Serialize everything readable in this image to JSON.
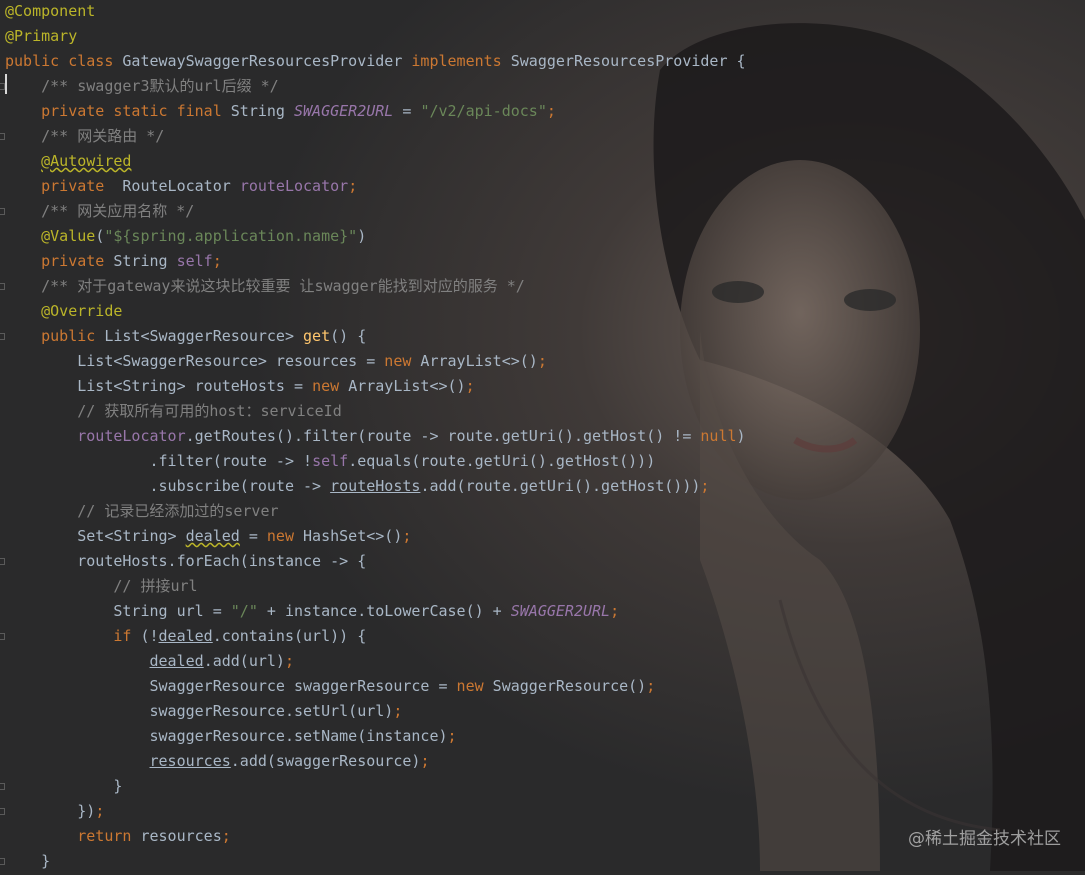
{
  "editor": {
    "lines": [
      [
        {
          "t": "@Component",
          "k": "an"
        }
      ],
      [
        {
          "t": "@Primary",
          "k": "an"
        }
      ],
      [
        {
          "t": "public class ",
          "k": "kw"
        },
        {
          "t": "GatewaySwaggerResourcesProvider ",
          "k": "tx"
        },
        {
          "t": "implements ",
          "k": "kw"
        },
        {
          "t": "SwaggerResourcesProvider {",
          "k": "tx"
        }
      ],
      [
        {
          "t": "    "
        },
        {
          "t": "/** swagger3默认的url后缀 */",
          "k": "cm"
        }
      ],
      [
        {
          "t": "    "
        },
        {
          "t": "private static final ",
          "k": "kw"
        },
        {
          "t": "String ",
          "k": "tx"
        },
        {
          "t": "SWAGGER2URL",
          "k": "st"
        },
        {
          "t": " = ",
          "k": "tx"
        },
        {
          "t": "\"/v2/api-docs\"",
          "k": "str"
        },
        {
          "t": ";",
          "k": "kw"
        }
      ],
      [
        {
          "t": "    "
        },
        {
          "t": "/** 网关路由 */",
          "k": "cm"
        }
      ],
      [
        {
          "t": "    "
        },
        {
          "t": "@Autowired",
          "k": "an",
          "u": "wv"
        }
      ],
      [
        {
          "t": "    "
        },
        {
          "t": "private  ",
          "k": "kw"
        },
        {
          "t": "RouteLocator ",
          "k": "tx"
        },
        {
          "t": "routeLocator",
          "k": "fd"
        },
        {
          "t": ";",
          "k": "kw"
        }
      ],
      [
        {
          "t": "    "
        },
        {
          "t": "/** 网关应用名称 */",
          "k": "cm"
        }
      ],
      [
        {
          "t": "    "
        },
        {
          "t": "@Value",
          "k": "an"
        },
        {
          "t": "(",
          "k": "tx"
        },
        {
          "t": "\"${spring.application.name}\"",
          "k": "str"
        },
        {
          "t": ")",
          "k": "tx"
        }
      ],
      [
        {
          "t": "    "
        },
        {
          "t": "private ",
          "k": "kw"
        },
        {
          "t": "String ",
          "k": "tx"
        },
        {
          "t": "self",
          "k": "fd"
        },
        {
          "t": ";",
          "k": "kw"
        }
      ],
      [
        {
          "t": "    "
        },
        {
          "t": "/** 对于gateway来说这块比较重要 让swagger能找到对应的服务 */",
          "k": "cm"
        }
      ],
      [
        {
          "t": "    "
        },
        {
          "t": "@Override",
          "k": "an"
        }
      ],
      [
        {
          "t": "    "
        },
        {
          "t": "public ",
          "k": "kw"
        },
        {
          "t": "List<SwaggerResource> ",
          "k": "tx"
        },
        {
          "t": "get",
          "k": "mt"
        },
        {
          "t": "() {",
          "k": "tx"
        }
      ],
      [
        {
          "t": "        "
        },
        {
          "t": "List<SwaggerResource> resources = ",
          "k": "tx"
        },
        {
          "t": "new ",
          "k": "kw"
        },
        {
          "t": "ArrayList<>()",
          "k": "tx"
        },
        {
          "t": ";",
          "k": "kw"
        }
      ],
      [
        {
          "t": "        "
        },
        {
          "t": "List<String> routeHosts = ",
          "k": "tx"
        },
        {
          "t": "new ",
          "k": "kw"
        },
        {
          "t": "ArrayList<>()",
          "k": "tx"
        },
        {
          "t": ";",
          "k": "kw"
        }
      ],
      [
        {
          "t": "        "
        },
        {
          "t": "// 获取所有可用的host：serviceId",
          "k": "cm"
        }
      ],
      [
        {
          "t": "        "
        },
        {
          "t": "routeLocator",
          "k": "fd"
        },
        {
          "t": ".getRoutes().filter(route -> route.getUri().getHost() != ",
          "k": "tx"
        },
        {
          "t": "null",
          "k": "kw"
        },
        {
          "t": ")",
          "k": "tx"
        }
      ],
      [
        {
          "t": "                "
        },
        {
          "t": ".filter(route -> !",
          "k": "tx"
        },
        {
          "t": "self",
          "k": "fd"
        },
        {
          "t": ".equals(route.getUri().getHost()))",
          "k": "tx"
        }
      ],
      [
        {
          "t": "                "
        },
        {
          "t": ".subscribe(route -> ",
          "k": "tx"
        },
        {
          "t": "routeHosts",
          "k": "tx",
          "u": "ul"
        },
        {
          "t": ".add(route.getUri().getHost()))",
          "k": "tx"
        },
        {
          "t": ";",
          "k": "kw"
        }
      ],
      [
        {
          "t": "        "
        },
        {
          "t": "// 记录已经添加过的server",
          "k": "cm"
        }
      ],
      [
        {
          "t": "        "
        },
        {
          "t": "Set<String> ",
          "k": "tx"
        },
        {
          "t": "dealed",
          "k": "tx",
          "u": "wv"
        },
        {
          "t": " = ",
          "k": "tx"
        },
        {
          "t": "new ",
          "k": "kw"
        },
        {
          "t": "HashSet<>()",
          "k": "tx"
        },
        {
          "t": ";",
          "k": "kw"
        }
      ],
      [
        {
          "t": "        "
        },
        {
          "t": "routeHosts.forEach(instance -> {",
          "k": "tx"
        }
      ],
      [
        {
          "t": "            "
        },
        {
          "t": "// 拼接url",
          "k": "cm"
        }
      ],
      [
        {
          "t": "            "
        },
        {
          "t": "String url = ",
          "k": "tx"
        },
        {
          "t": "\"/\"",
          "k": "str"
        },
        {
          "t": " + instance.toLowerCase() + ",
          "k": "tx"
        },
        {
          "t": "SWAGGER2URL",
          "k": "st"
        },
        {
          "t": ";",
          "k": "kw"
        }
      ],
      [
        {
          "t": "            "
        },
        {
          "t": "if ",
          "k": "kw"
        },
        {
          "t": "(!",
          "k": "tx"
        },
        {
          "t": "dealed",
          "k": "tx",
          "u": "ul"
        },
        {
          "t": ".contains(url)) {",
          "k": "tx"
        }
      ],
      [
        {
          "t": "                "
        },
        {
          "t": "dealed",
          "k": "tx",
          "u": "ul"
        },
        {
          "t": ".add(url)",
          "k": "tx"
        },
        {
          "t": ";",
          "k": "kw"
        }
      ],
      [
        {
          "t": "                "
        },
        {
          "t": "SwaggerResource swaggerResource = ",
          "k": "tx"
        },
        {
          "t": "new ",
          "k": "kw"
        },
        {
          "t": "SwaggerResource()",
          "k": "tx"
        },
        {
          "t": ";",
          "k": "kw"
        }
      ],
      [
        {
          "t": "                "
        },
        {
          "t": "swaggerResource.setUrl(url)",
          "k": "tx"
        },
        {
          "t": ";",
          "k": "kw"
        }
      ],
      [
        {
          "t": "                "
        },
        {
          "t": "swaggerResource.setName(instance)",
          "k": "tx"
        },
        {
          "t": ";",
          "k": "kw"
        }
      ],
      [
        {
          "t": "                "
        },
        {
          "t": "resources",
          "k": "tx",
          "u": "ul"
        },
        {
          "t": ".add(swaggerResource)",
          "k": "tx"
        },
        {
          "t": ";",
          "k": "kw"
        }
      ],
      [
        {
          "t": "            "
        },
        {
          "t": "}",
          "k": "tx"
        }
      ],
      [
        {
          "t": "        "
        },
        {
          "t": "})",
          "k": "tx"
        },
        {
          "t": ";",
          "k": "kw"
        }
      ],
      [
        {
          "t": "        "
        },
        {
          "t": "return ",
          "k": "kw"
        },
        {
          "t": "resources",
          "k": "tx"
        },
        {
          "t": ";",
          "k": "kw"
        }
      ],
      [
        {
          "t": "    "
        },
        {
          "t": "}",
          "k": "tx"
        }
      ]
    ]
  },
  "watermark": "@稀土掘金技术社区",
  "colors": {
    "background": "#2b2b2b",
    "keyword": "#cc7832",
    "annotation": "#bbb529",
    "field": "#9876aa",
    "string": "#6a8759",
    "comment": "#808080",
    "method": "#ffc66d",
    "text": "#a9b7c6"
  }
}
